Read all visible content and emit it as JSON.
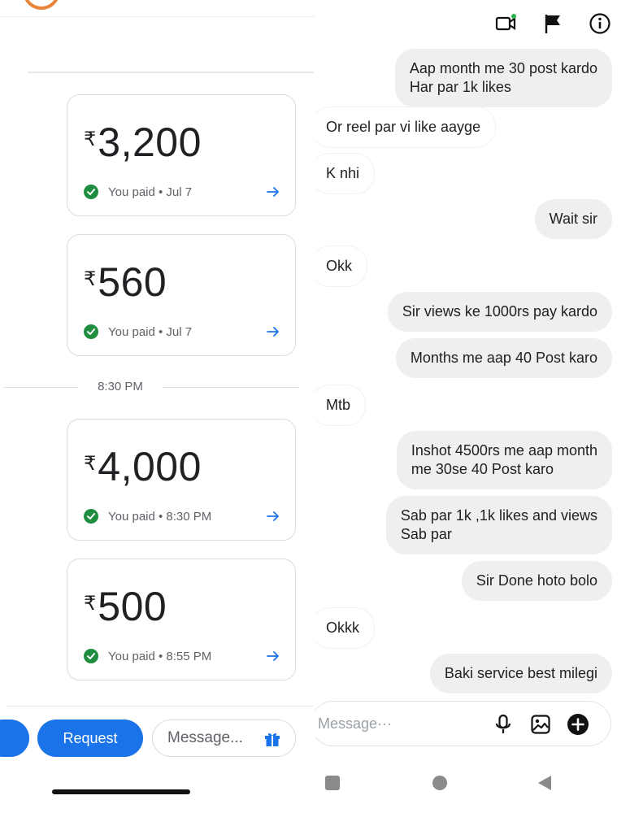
{
  "payments": {
    "currency_symbol": "₹",
    "cards": [
      {
        "amount": "3,200",
        "status": "You paid • Jul 7"
      },
      {
        "amount": "560",
        "status": "You paid • Jul 7"
      },
      {
        "amount": "4,000",
        "status": "You paid • 8:30 PM"
      },
      {
        "amount": "500",
        "status": "You paid • 8:55 PM"
      }
    ],
    "time_separator": "8:30 PM",
    "request_label": "Request",
    "message_placeholder": "Message..."
  },
  "chat": {
    "messages": [
      {
        "direction": "sent",
        "text": "Aap month me 30 post kardo\nHar par 1k likes"
      },
      {
        "direction": "received",
        "text": "Or reel par vi like aayge"
      },
      {
        "direction": "received",
        "text": "K nhi"
      },
      {
        "direction": "sent",
        "text": "Wait sir"
      },
      {
        "direction": "received",
        "text": "Okk"
      },
      {
        "direction": "sent",
        "text": "Sir views ke 1000rs pay kardo"
      },
      {
        "direction": "sent",
        "text": "Months me aap 40 Post  karo"
      },
      {
        "direction": "received",
        "text": "Mtb"
      },
      {
        "direction": "sent",
        "text": "Inshot 4500rs me aap month\nme 30se 40 Post karo"
      },
      {
        "direction": "sent",
        "text": "Sab par  1k ,1k likes and views\nSab par"
      },
      {
        "direction": "sent",
        "text": "Sir Done hoto bolo"
      },
      {
        "direction": "received",
        "text": "Okkk"
      },
      {
        "direction": "sent",
        "text": "Baki service best milegi"
      }
    ],
    "compose_placeholder": "Message···"
  },
  "icons": {
    "check": "check-circle-icon",
    "arrow": "arrow-right-icon",
    "gift": "gift-icon",
    "video_call": "video-call-icon",
    "flag": "flag-icon",
    "info": "info-icon",
    "mic": "microphone-icon",
    "image": "image-icon",
    "plus": "plus-circle-icon"
  },
  "colors": {
    "accent_blue": "#1a73e8",
    "success_green": "#1e8e3e",
    "sent_bubble": "#efefef"
  }
}
